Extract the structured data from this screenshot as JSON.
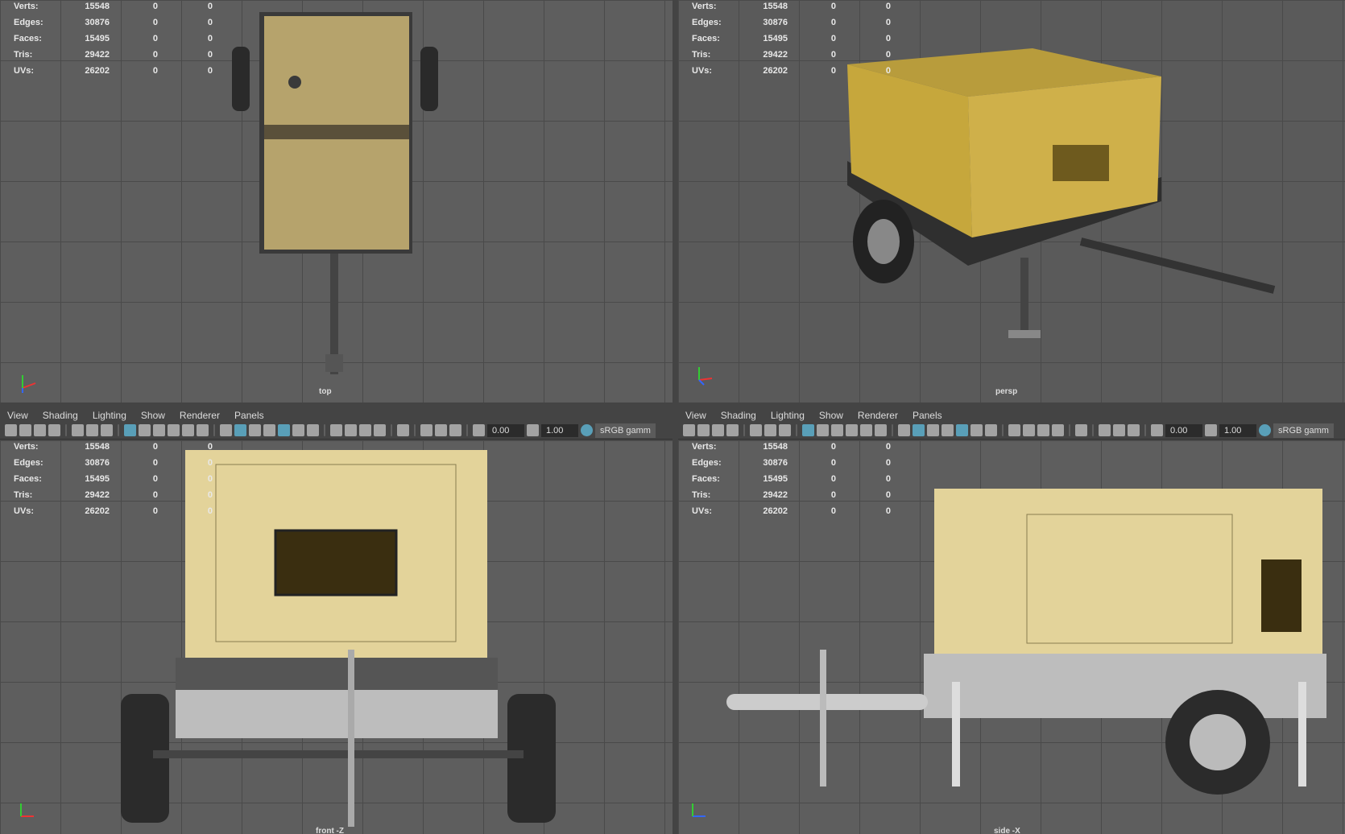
{
  "stats": {
    "rows": [
      {
        "label": "Verts:",
        "value": "15548",
        "a": "0",
        "b": "0"
      },
      {
        "label": "Edges:",
        "value": "30876",
        "a": "0",
        "b": "0"
      },
      {
        "label": "Faces:",
        "value": "15495",
        "a": "0",
        "b": "0"
      },
      {
        "label": "Tris:",
        "value": "29422",
        "a": "0",
        "b": "0"
      },
      {
        "label": "UVs:",
        "value": "26202",
        "a": "0",
        "b": "0"
      }
    ]
  },
  "viewports": {
    "top": "top",
    "persp": "persp",
    "front": "front -Z",
    "side": "side -X"
  },
  "menu": [
    "View",
    "Shading",
    "Lighting",
    "Show",
    "Renderer",
    "Panels"
  ],
  "toolbar": {
    "exposure": "0.00",
    "gamma": "1.00",
    "colorspace": "sRGB gamm"
  },
  "colors": {
    "accent": "#5fb6d6",
    "body": "#c9b46a",
    "grid": "#5e5e5e"
  }
}
